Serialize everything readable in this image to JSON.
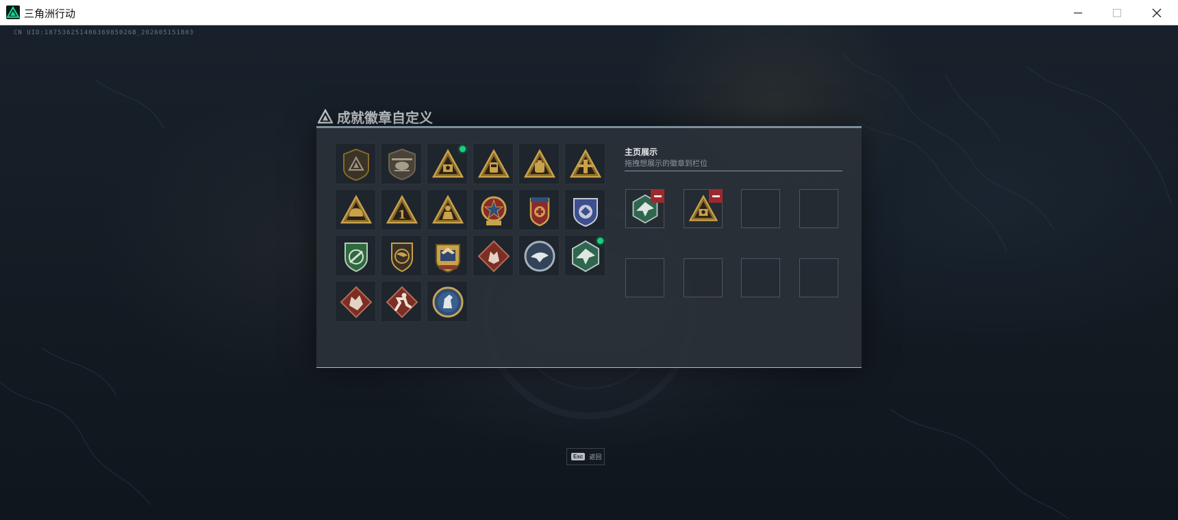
{
  "window": {
    "title": "三角洲行动",
    "minimize_glyph": "—",
    "maximize_glyph": "☐",
    "close_glyph": "✕"
  },
  "uid_text": "CN UID:18753625140636985026B_202605151803",
  "panel": {
    "heading": "成就徽章自定义",
    "badges": [
      {
        "icon": "triangle-shield-badge-icon",
        "new": false
      },
      {
        "icon": "helicopter-badge-icon",
        "new": false
      },
      {
        "icon": "gold-triangle-crate-badge-icon",
        "new": true
      },
      {
        "icon": "gold-triangle-device-badge-icon",
        "new": false
      },
      {
        "icon": "gold-triangle-backpack-badge-icon",
        "new": false
      },
      {
        "icon": "gold-triangle-tower-badge-icon",
        "new": false
      },
      {
        "icon": "gold-triangle-helmet-badge-icon",
        "new": false
      },
      {
        "icon": "gold-triangle-number-one-badge-icon",
        "new": false
      },
      {
        "icon": "gold-triangle-soldier-badge-icon",
        "new": false
      },
      {
        "icon": "star-cross-medal-badge-icon",
        "new": false
      },
      {
        "icon": "medic-cross-medal-badge-icon",
        "new": false
      },
      {
        "icon": "blue-eagle-shield-badge-icon",
        "new": false
      },
      {
        "icon": "green-wreath-shield-badge-icon",
        "new": false
      },
      {
        "icon": "bronze-bird-shield-badge-icon",
        "new": false
      },
      {
        "icon": "gold-eagle-crest-badge-icon",
        "new": false
      },
      {
        "icon": "wolf-diamond-badge-icon",
        "new": false
      },
      {
        "icon": "eagle-circle-badge-icon",
        "new": false
      },
      {
        "icon": "green-eagle-hexagon-badge-icon",
        "new": true
      },
      {
        "icon": "beast-diamond-badge-icon",
        "new": false
      },
      {
        "icon": "runner-diamond-badge-icon",
        "new": false
      },
      {
        "icon": "horse-circle-badge-icon",
        "new": false
      }
    ],
    "showcase": {
      "title": "主页展示",
      "subtitle": "拖拽想展示的徽章到栏位",
      "slots": [
        {
          "icon": "green-eagle-hexagon-badge-icon",
          "filled": true
        },
        {
          "icon": "gold-triangle-crate-badge-icon",
          "filled": true
        },
        {
          "icon": "",
          "filled": false
        },
        {
          "icon": "",
          "filled": false
        },
        {
          "icon": "",
          "filled": false
        },
        {
          "icon": "",
          "filled": false
        },
        {
          "icon": "",
          "filled": false
        },
        {
          "icon": "",
          "filled": false
        }
      ]
    }
  },
  "footer": {
    "esc_key": "Esc",
    "esc_label": "返回"
  },
  "colors": {
    "accent_green": "#16d07a",
    "remove_red": "#9b2a2e",
    "gold": "#c9a24a"
  }
}
